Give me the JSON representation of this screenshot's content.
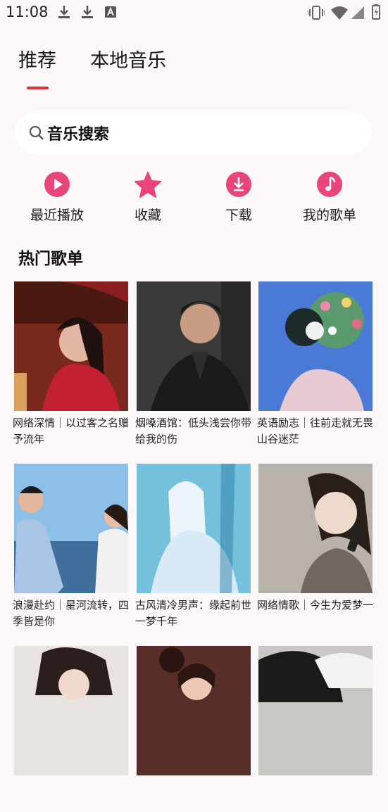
{
  "status_bar": {
    "time": "11:08"
  },
  "tabs": [
    {
      "label": "推荐",
      "active": true
    },
    {
      "label": "本地音乐",
      "active": false
    }
  ],
  "search": {
    "placeholder": "音乐搜索"
  },
  "quick_actions": [
    {
      "label": "最近播放",
      "icon": "play-icon"
    },
    {
      "label": "收藏",
      "icon": "star-icon"
    },
    {
      "label": "下载",
      "icon": "download-icon"
    },
    {
      "label": "我的歌单",
      "icon": "music-note-icon"
    }
  ],
  "section": {
    "title": "热门歌单"
  },
  "playlists": [
    {
      "line1": "网络深情｜以过客之名赠",
      "line2": "予流年"
    },
    {
      "line1": "烟嗓酒馆：低头浅尝你带",
      "line2": "给我的伤"
    },
    {
      "line1": "英语励志｜往前走就无畏",
      "line2": "山谷迷茫"
    },
    {
      "line1": "浪漫赴约｜星河流转，四",
      "line2": "季皆是你"
    },
    {
      "line1": "古风清冷男声：缘起前世",
      "line2": "一梦千年"
    },
    {
      "line1": "网络情歌｜今生为爱梦一场",
      "line2": ""
    },
    {
      "line1": "",
      "line2": ""
    },
    {
      "line1": "",
      "line2": ""
    },
    {
      "line1": "",
      "line2": ""
    }
  ],
  "colors": {
    "accent": "#e0303a",
    "icon_pink": "#e8457a",
    "background": "#fcf7f8"
  }
}
